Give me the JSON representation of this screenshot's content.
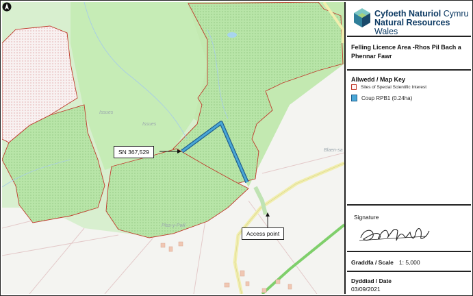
{
  "logo": {
    "line1_bold": "Cyfoeth Naturiol",
    "line1_regular": " Cymru",
    "line2_bold": "Natural Resources",
    "line2_regular": " Wales"
  },
  "title": "Felling Licence Area -Rhos Pil Bach a Phennar Fawr",
  "map_key": {
    "heading": "Allwedd / Map Key",
    "items": [
      {
        "label": "Sites of Special Scientific Interest",
        "symbol": "sssi-swatch",
        "color": "#c0392b"
      },
      {
        "label": "Coup RPB1 (0.24ha)",
        "symbol": "coup-swatch",
        "color": "#4aa7d6"
      }
    ]
  },
  "signature": {
    "label": "Signature"
  },
  "scale": {
    "label": "Graddfa / Scale",
    "value": "1: 5,000"
  },
  "date": {
    "label": "Dyddiad / Date",
    "value": "03/09/2021"
  },
  "map": {
    "callouts": {
      "grid_ref": "SN 367,529",
      "access": "Access point"
    },
    "place_names": [
      "Issues",
      "Issues",
      "Blaen-sa",
      "Plas-y-Pwll"
    ],
    "colors": {
      "woodland": "#b8e5a8",
      "light_green": "#d8efcf",
      "sssi_outline": "#c0392b",
      "coup": "#4aa7d6",
      "road": "#f1eeae",
      "rail": "#7fcf6b"
    }
  }
}
